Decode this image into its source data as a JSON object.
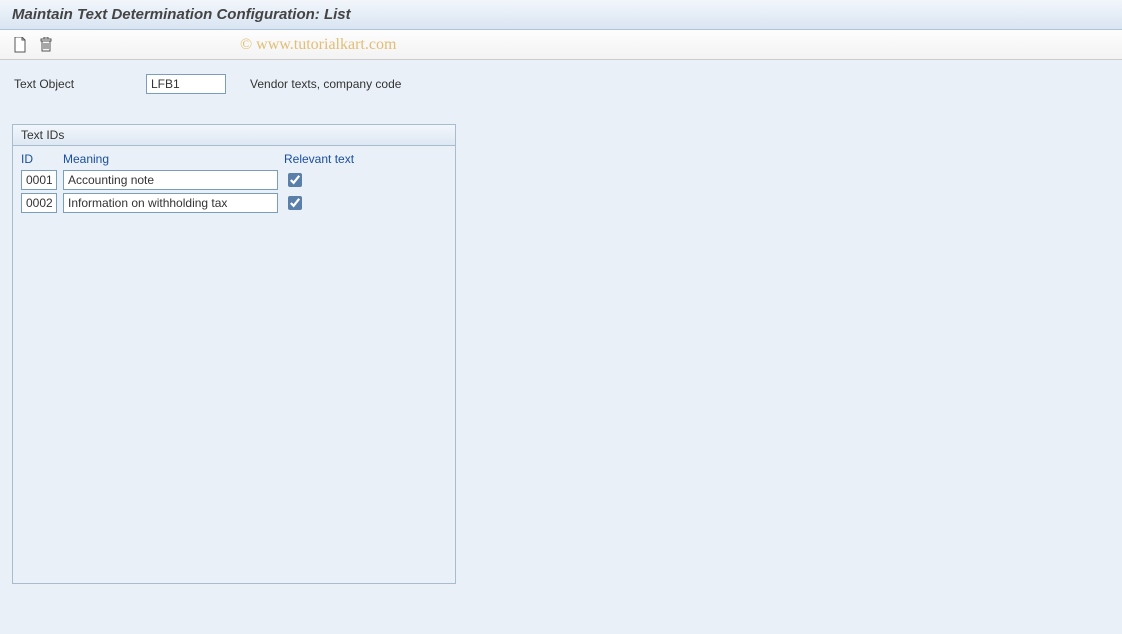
{
  "header": {
    "title": "Maintain Text Determination Configuration: List"
  },
  "watermark": "© www.tutorialkart.com",
  "fields": {
    "text_object_label": "Text Object",
    "text_object_value": "LFB1",
    "text_object_desc": "Vendor texts, company code"
  },
  "panel": {
    "title": "Text IDs",
    "columns": {
      "id": "ID",
      "meaning": "Meaning",
      "relevant": "Relevant text"
    },
    "rows": [
      {
        "id": "0001",
        "meaning": "Accounting note",
        "relevant": true
      },
      {
        "id": "0002",
        "meaning": "Information on withholding tax",
        "relevant": true
      }
    ]
  }
}
